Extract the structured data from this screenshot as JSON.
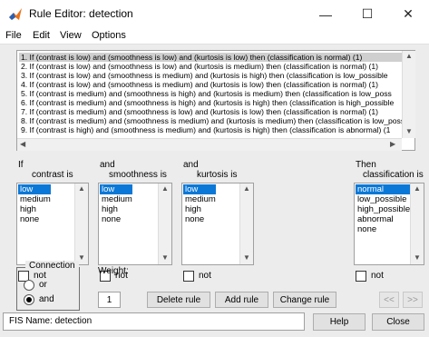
{
  "window": {
    "title": "Rule Editor: detection",
    "minimize_glyph": "—",
    "maximize_glyph": "☐",
    "close_glyph": "✕"
  },
  "menu": [
    "File",
    "Edit",
    "View",
    "Options"
  ],
  "rules": [
    "1. If (contrast is low) and (smoothness is low) and (kurtosis is low) then (classification is normal) (1)",
    "2. If (contrast is low) and (smoothness is low) and (kurtosis is medium) then (classification is normal) (1)",
    "3. If (contrast is low) and (smoothness is medium) and (kurtosis is high) then (classification is low_possible",
    "4. If (contrast is low) and (smoothness is medium) and (kurtosis is low) then (classification is normal) (1)",
    "5. If (contrast is medium) and (smoothness is high) and (kurtosis is medium) then (classification is low_poss",
    "6. If (contrast is medium) and (smoothness is high) and (kurtosis is high) then (classification is high_possible",
    "7. If (contrast is medium) and (smoothness is low) and (kurtosis is low) then (classification is normal) (1)",
    "8. If (contrast is medium) and (smoothness is medium) and (kurtosis is medium) then (classification is low_poss",
    "9. If (contrast is high) and (smoothness is medium) and (kurtosis is high) then (classification is abnormal) (1"
  ],
  "selected_rule": 1,
  "inputs": [
    {
      "prefix": "If",
      "var_label": "contrast is",
      "options": [
        "low",
        "medium",
        "high",
        "none"
      ],
      "selected": "low",
      "not_label": "not"
    },
    {
      "prefix": "and",
      "var_label": "smoothness is",
      "options": [
        "low",
        "medium",
        "high",
        "none"
      ],
      "selected": "low",
      "not_label": "not"
    },
    {
      "prefix": "and",
      "var_label": "kurtosis is",
      "options": [
        "low",
        "medium",
        "high",
        "none"
      ],
      "selected": "low",
      "not_label": "not"
    }
  ],
  "output": {
    "prefix": "Then",
    "var_label": "classification is",
    "options": [
      "normal",
      "low_possible",
      "high_possible",
      "abnormal",
      "none"
    ],
    "selected": "normal",
    "not_label": "not"
  },
  "connection": {
    "title": "Connection",
    "options": [
      "or",
      "and"
    ],
    "selected": "and"
  },
  "weight": {
    "label": "Weight:",
    "value": "1"
  },
  "buttons": {
    "delete_rule": "Delete rule",
    "add_rule": "Add rule",
    "change_rule": "Change rule",
    "prev": "<<",
    "next": ">>",
    "help": "Help",
    "close": "Close"
  },
  "status": "FIS Name: detection",
  "colors": {
    "selection": "#0b78d7",
    "icon_orange": "#e8731c",
    "icon_blue": "#2b5fb4"
  }
}
